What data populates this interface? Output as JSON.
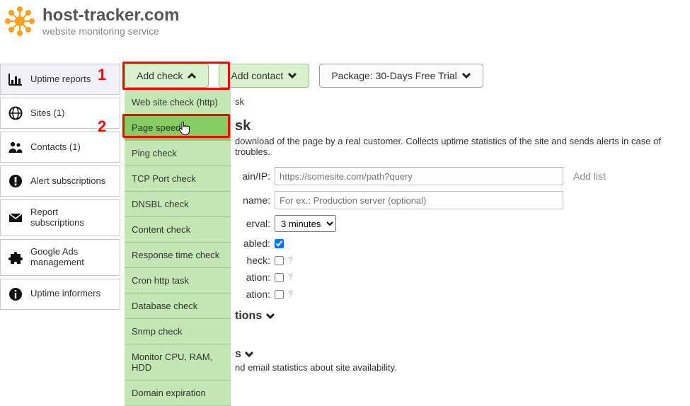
{
  "header": {
    "title": "host-tracker.com",
    "subtitle": "website monitoring service"
  },
  "annotations": {
    "one": "1",
    "two": "2"
  },
  "toolbar": {
    "addCheck": "Add check",
    "addContact": "Add contact",
    "package": "Package: 30-Days Free Trial"
  },
  "sidebar": [
    {
      "label": "Uptime reports"
    },
    {
      "label": "Sites (1)"
    },
    {
      "label": "Contacts (1)"
    },
    {
      "label": "Alert subscriptions"
    },
    {
      "label": "Report subscriptions"
    },
    {
      "label": "Google Ads management"
    },
    {
      "label": "Uptime informers"
    }
  ],
  "dropdown": [
    "Web site check (http)",
    "Page speed",
    "Ping check",
    "TCP Port check",
    "DNSBL check",
    "Content check",
    "Response time check",
    "Cron http task",
    "Database check",
    "Snmp check",
    "Monitor CPU, RAM, HDD",
    "Domain expiration"
  ],
  "task": {
    "peek": "sk",
    "title_peek": "sk",
    "desc": "download of the page by a real customer. Collects uptime statistics of the site and sends alerts in case of troubles.",
    "fields": {
      "domainLabel": "ain/IP:",
      "domainPlaceholder": "https://somesite.com/path?query",
      "addList": "Add list",
      "nameLabel": "name:",
      "namePlaceholder": "For ex.: Production server (optional)",
      "intervalLabel": "erval:",
      "intervalValue": "3 minutes",
      "enabledLabel": "abled:",
      "checkLabel": "heck:",
      "ration1Label": "ation:",
      "ration2Label": "ation:"
    },
    "sections": {
      "s1_peek": "tions",
      "s2_peek": "s",
      "s2_desc": "nd email statistics about site availability."
    }
  }
}
